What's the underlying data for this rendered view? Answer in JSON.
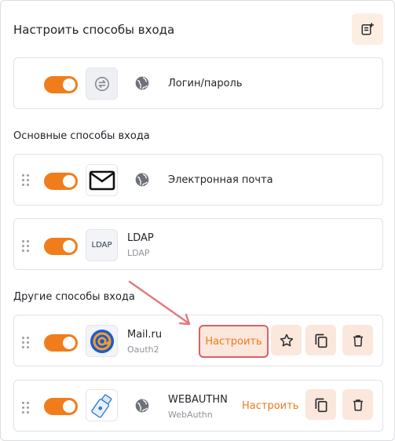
{
  "header": {
    "title": "Настроить способы входа",
    "add_icon": "add-note-icon"
  },
  "login_password": {
    "label": "Логин/пароль",
    "icon": "swap-arrows-icon",
    "enabled": true
  },
  "sections": {
    "main_label": "Основные способы входа",
    "other_label": "Другие способы входа"
  },
  "main_methods": [
    {
      "label": "Электронная почта",
      "icon": "envelope-icon",
      "enabled": true
    },
    {
      "label": "LDAP",
      "sublabel": "LDAP",
      "tile_text": "LDAP",
      "enabled": true
    }
  ],
  "other_methods": [
    {
      "label": "Mail.ru",
      "sublabel": "Oauth2",
      "icon": "mailru-at-icon",
      "configure_label": "Настроить",
      "enabled": true
    },
    {
      "label": "WEBAUTHN",
      "sublabel": "WebAuthn",
      "icon": "usb-key-icon",
      "configure_label": "Настроить",
      "enabled": true
    }
  ],
  "colors": {
    "accent": "#f07d1b",
    "action_bg": "#fbe7dc",
    "highlight": "#d9606a"
  }
}
